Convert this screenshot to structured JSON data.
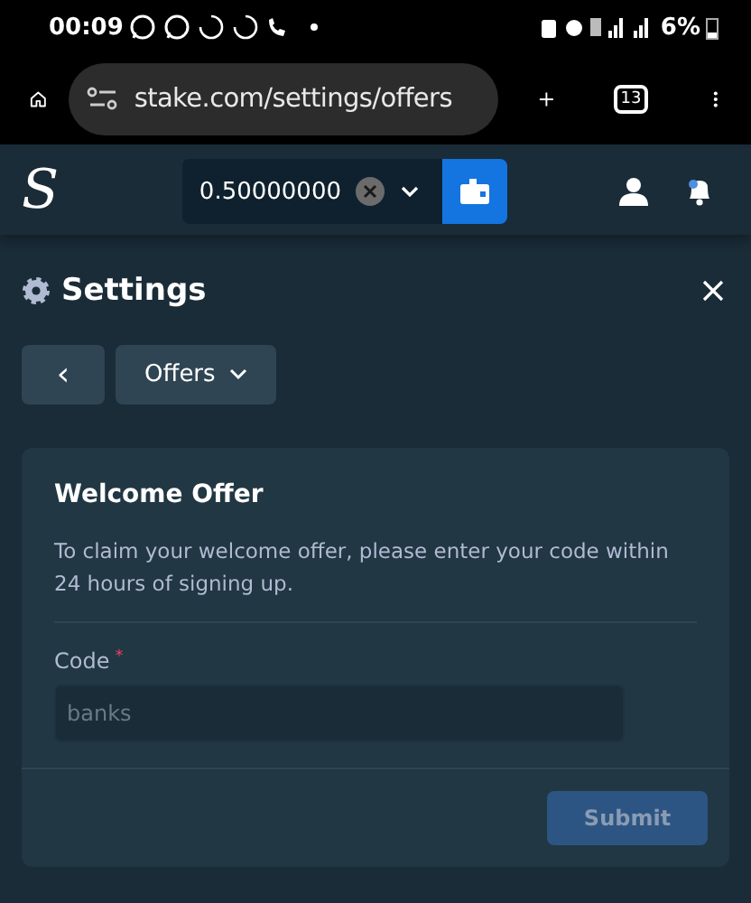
{
  "status_bar": {
    "time": "00:09",
    "battery": "6%"
  },
  "browser": {
    "url": "stake.com/settings/offers",
    "tab_count": "13"
  },
  "header": {
    "logo": "S",
    "balance": "0.50000000"
  },
  "page": {
    "title": "Settings",
    "back_label": "‹",
    "section_dropdown": "Offers"
  },
  "card": {
    "title": "Welcome Offer",
    "description": "To claim your welcome offer, please enter your code within 24 hours of signing up.",
    "field_label": "Code",
    "required_mark": "*",
    "field_placeholder": "banks",
    "submit": {
      "label": "Submit",
      "disabled": true
    }
  }
}
